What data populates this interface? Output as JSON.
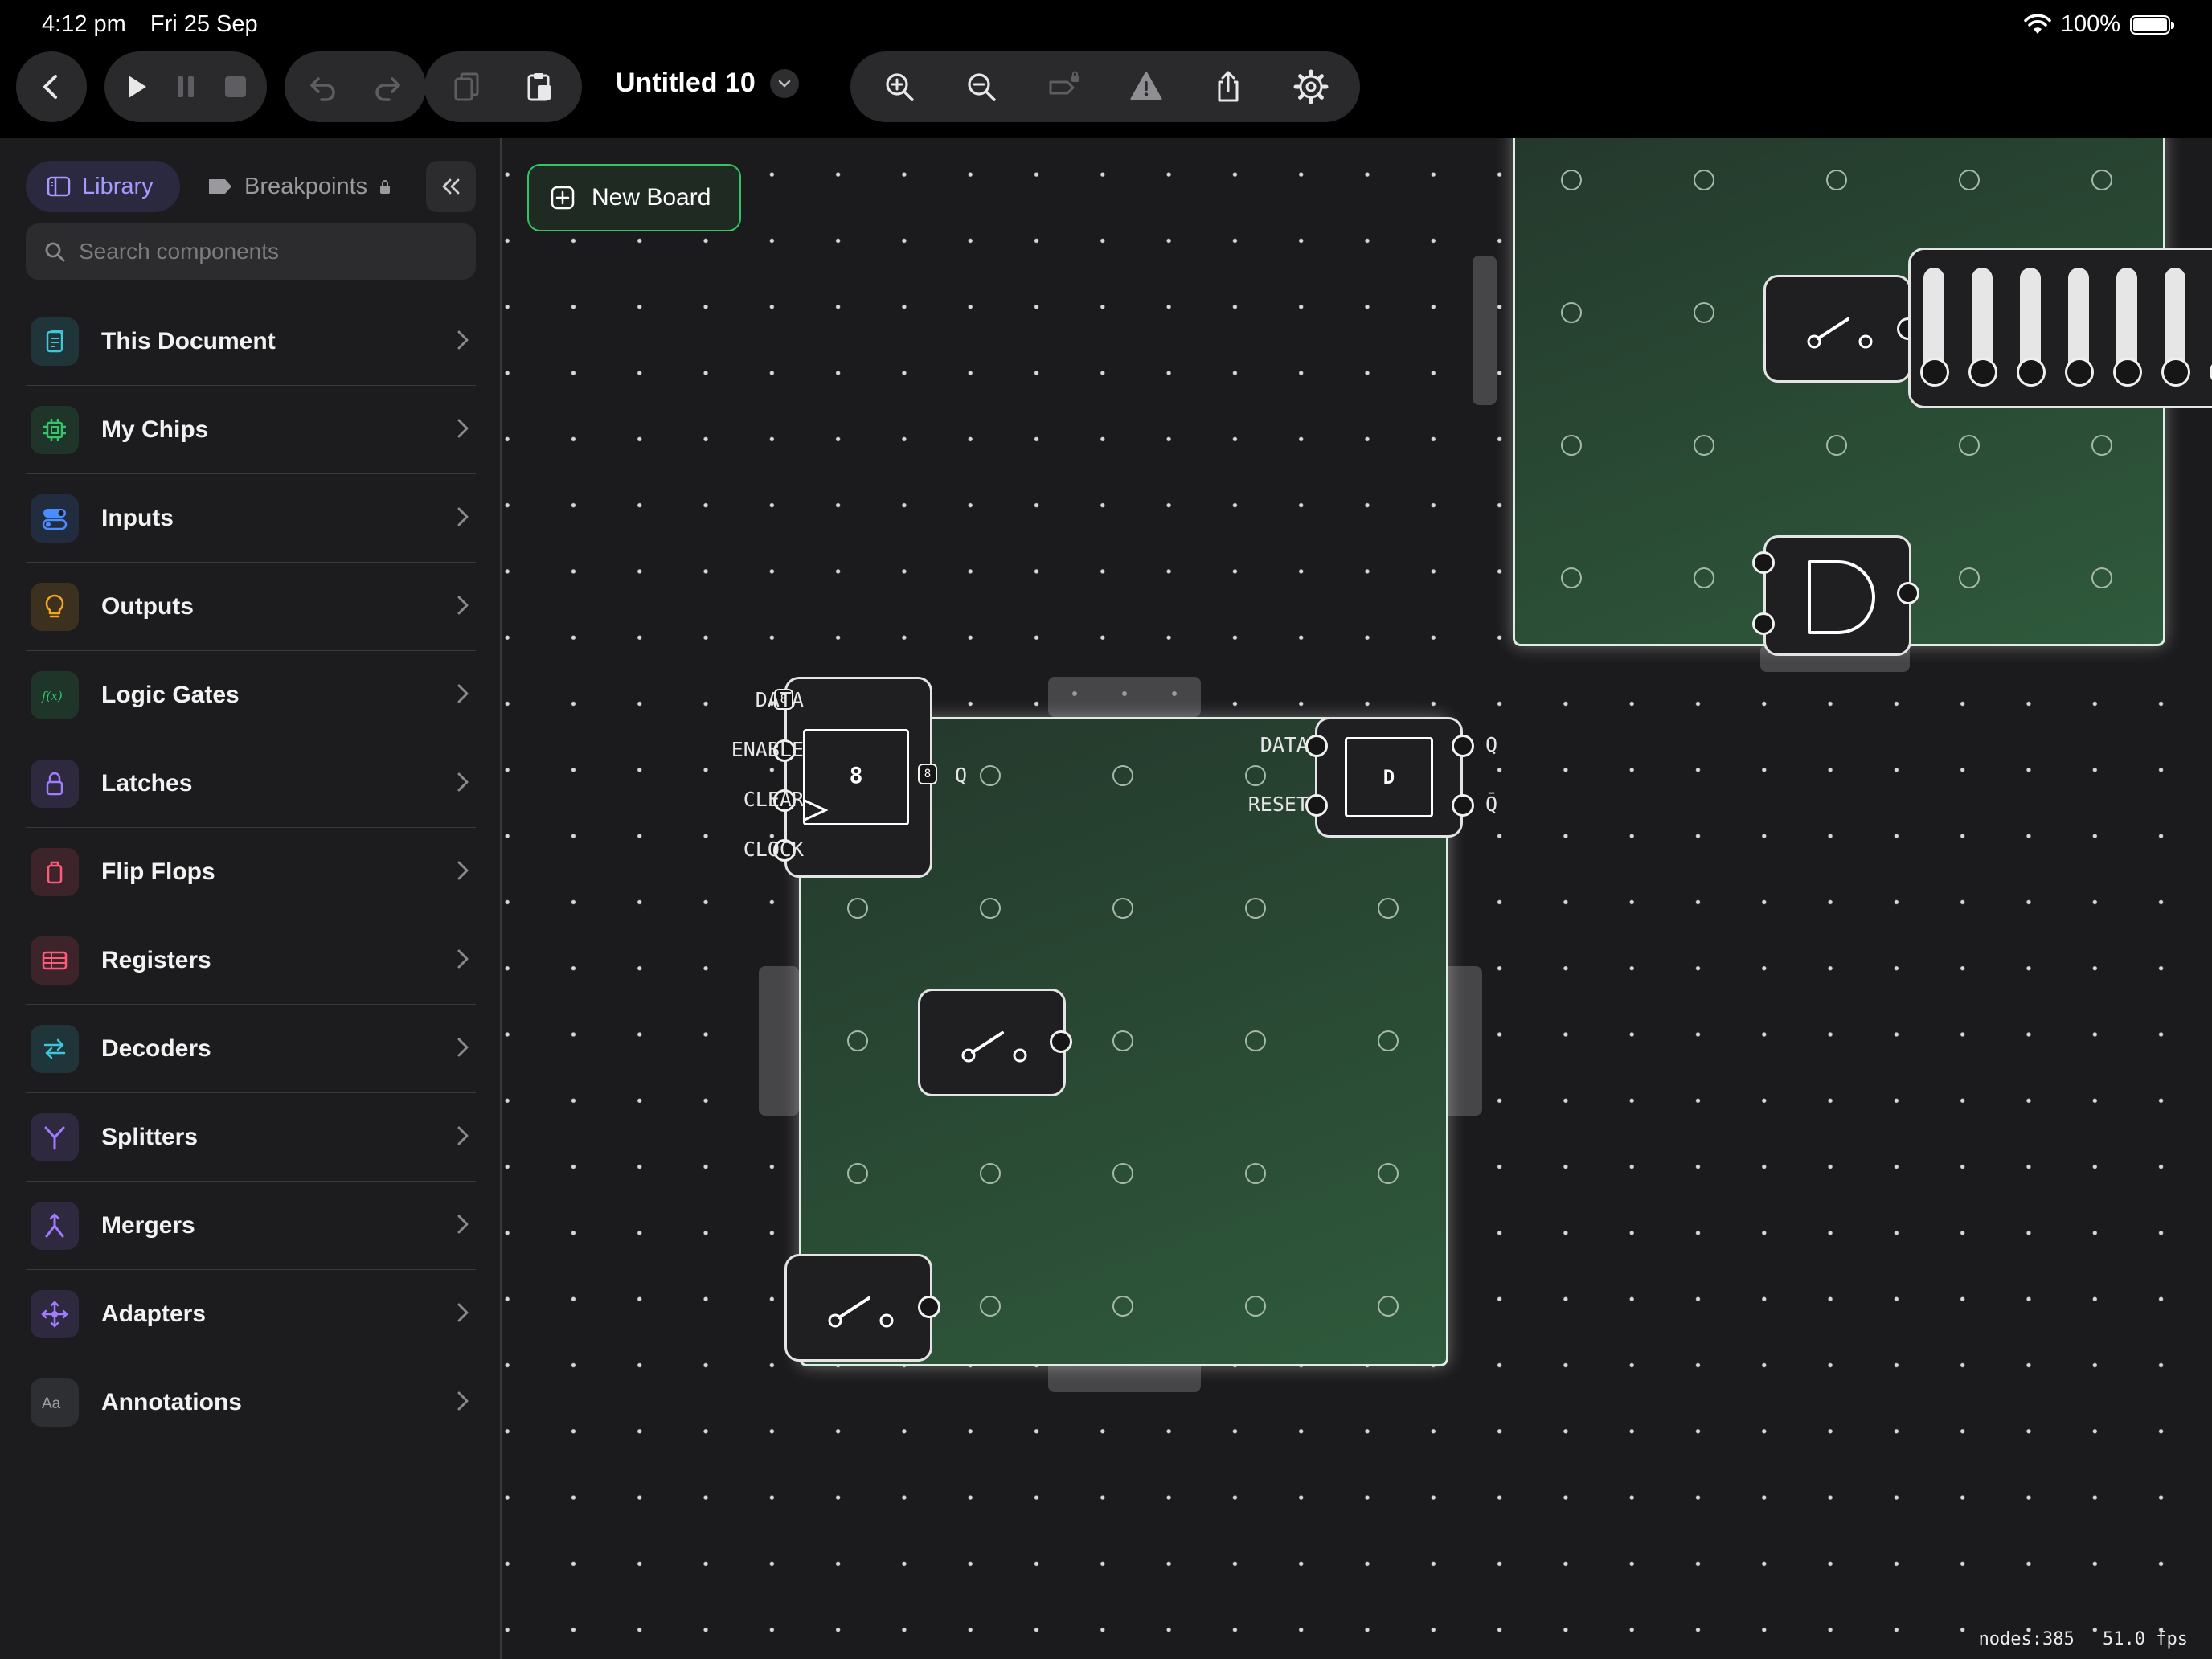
{
  "status_bar": {
    "time": "4:12 pm",
    "date": "Fri 25 Sep",
    "battery": "100%"
  },
  "toolbar": {
    "document_title": "Untitled 10"
  },
  "sidebar": {
    "tabs": {
      "library": "Library",
      "breakpoints": "Breakpoints"
    },
    "search_placeholder": "Search components",
    "categories": [
      {
        "label": "This Document",
        "icon": "document-icon",
        "color": "#3fc6d9"
      },
      {
        "label": "My Chips",
        "icon": "chip-icon",
        "color": "#35c66b"
      },
      {
        "label": "Inputs",
        "icon": "toggles-icon",
        "color": "#4a8dff"
      },
      {
        "label": "Outputs",
        "icon": "lightbulb-icon",
        "color": "#f5a623"
      },
      {
        "label": "Logic Gates",
        "icon": "function-icon",
        "color": "#35c66b"
      },
      {
        "label": "Latches",
        "icon": "lock-icon",
        "color": "#a07cff"
      },
      {
        "label": "Flip Flops",
        "icon": "trash-icon",
        "color": "#ff5a7a"
      },
      {
        "label": "Registers",
        "icon": "table-icon",
        "color": "#ff5a7a"
      },
      {
        "label": "Decoders",
        "icon": "arrows-icon",
        "color": "#3fc6d9"
      },
      {
        "label": "Splitters",
        "icon": "splitter-icon",
        "color": "#a07cff"
      },
      {
        "label": "Mergers",
        "icon": "merger-icon",
        "color": "#a07cff"
      },
      {
        "label": "Adapters",
        "icon": "move-icon",
        "color": "#a07cff"
      },
      {
        "label": "Annotations",
        "icon": "text-icon",
        "color": "#9aa0a6"
      }
    ]
  },
  "canvas": {
    "new_board_label": "New Board",
    "register": {
      "bits": "8",
      "inputs": [
        "DATA",
        "ENABLE",
        "CLEAR",
        "CLOCK"
      ],
      "output": "Q",
      "bus_width": "8"
    },
    "d_flip_flop": {
      "label": "D",
      "inputs": [
        "DATA",
        "RESET"
      ],
      "outputs": [
        "Q",
        "Q̄"
      ]
    },
    "stats": {
      "nodes": "nodes:385",
      "fps": "51.0 fps"
    }
  }
}
